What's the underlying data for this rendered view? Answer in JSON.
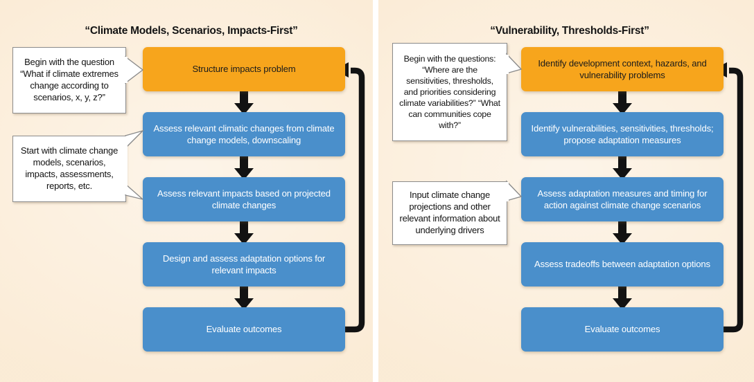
{
  "figure": {
    "background_color": "#fcefdd",
    "box_orange_color": "#f7a51c",
    "box_blue_color": "#4a8fcb",
    "arrow_color": "#121212",
    "note_border_color": "#8b8b8b"
  },
  "panels": [
    {
      "id": "impacts-first",
      "title": "“Climate Models, Scenarios, Impacts-First”",
      "steps": [
        {
          "label": "Structure impacts problem",
          "color": "orange"
        },
        {
          "label": "Assess relevant climatic changes from climate change models, downscaling",
          "color": "blue"
        },
        {
          "label": "Assess relevant impacts based on projected climate changes",
          "color": "blue"
        },
        {
          "label": "Design and assess adaptation options for relevant impacts",
          "color": "blue"
        },
        {
          "label": "Evaluate outcomes",
          "color": "blue"
        }
      ],
      "notes": [
        {
          "text": "Begin with the question “What if climate extremes change according to scenarios, x, y, z?”",
          "targets": [
            0
          ]
        },
        {
          "text": "Start with climate change models, scenarios, impacts, assessments, reports, etc.",
          "targets": [
            1,
            2
          ]
        }
      ],
      "feedback_arrow": {
        "from": "Evaluate outcomes",
        "to": "Structure impacts problem"
      }
    },
    {
      "id": "vulnerability-first",
      "title": "“Vulnerability, Thresholds-First”",
      "steps": [
        {
          "label": "Identify development context, hazards, and vulnerability problems",
          "color": "orange"
        },
        {
          "label": "Identify vulnerabilities, sensitivities, thresholds; propose adaptation measures",
          "color": "blue"
        },
        {
          "label": "Assess adaptation measures and timing for action against climate change scenarios",
          "color": "blue"
        },
        {
          "label": "Assess tradeoffs between adaptation options",
          "color": "blue"
        },
        {
          "label": "Evaluate outcomes",
          "color": "blue"
        }
      ],
      "notes": [
        {
          "text": "Begin with the questions: “Where are the sensitivities, thresholds, and priorities considering climate variabilities?” “What can communities cope with?”",
          "targets": [
            0
          ]
        },
        {
          "text": "Input climate change projections and other relevant information about underlying drivers",
          "targets": [
            2
          ]
        }
      ],
      "feedback_arrow": {
        "from": "Evaluate outcomes",
        "to": "Identify development context, hazards, and vulnerability problems"
      }
    }
  ]
}
